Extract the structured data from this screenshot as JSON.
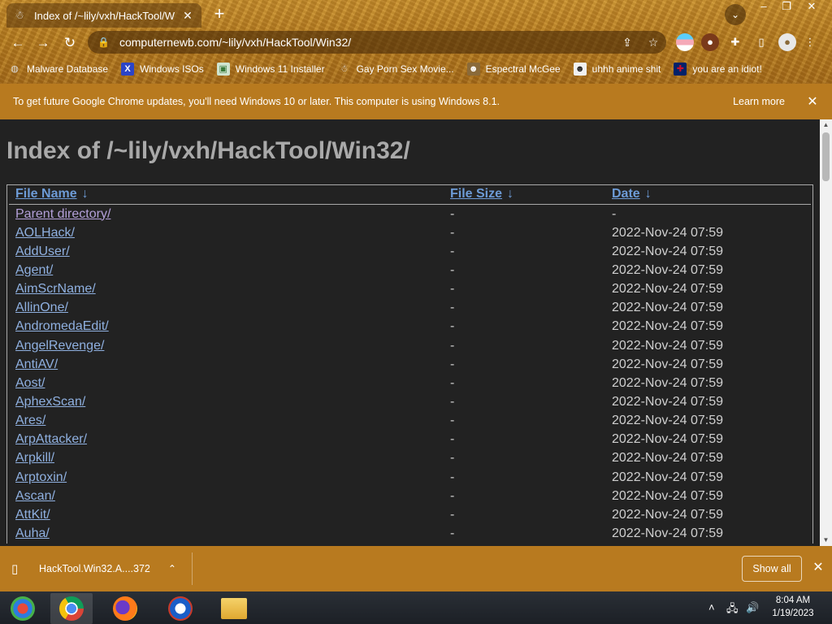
{
  "tab": {
    "title": "Index of /~lily/vxh/HackTool/W",
    "close": "✕"
  },
  "omnibox": {
    "url": "computernewb.com/~lily/vxh/HackTool/Win32/"
  },
  "bookmarks": [
    {
      "label": "Malware Database",
      "icon": "globe-icon",
      "color": "#6b6b6b"
    },
    {
      "label": "Windows ISOs",
      "icon": "x-icon",
      "color": "#2b44c8"
    },
    {
      "label": "Windows 11 Installer",
      "icon": "image-icon",
      "color": "#4a9a4a"
    },
    {
      "label": "Gay Porn Sex Movie...",
      "icon": "site-icon",
      "color": "#555555"
    },
    {
      "label": "Espectral McGee",
      "icon": "avatar-icon",
      "color": "#8a6a3a"
    },
    {
      "label": "uhhh anime shit",
      "icon": "avatar-icon",
      "color": "#f0f0f0"
    },
    {
      "label": "you are an idiot!",
      "icon": "flag-icon",
      "color": "#c8102e"
    }
  ],
  "infobar": {
    "message": "To get future Google Chrome updates, you'll need Windows 10 or later. This computer is using Windows 8.1.",
    "learn_more": "Learn more"
  },
  "page": {
    "heading": "Index of /~lily/vxh/HackTool/Win32/",
    "columns": {
      "name": "File Name",
      "size": "File Size",
      "date": "Date",
      "sort_arrow": "↓"
    },
    "rows": [
      {
        "name": "Parent directory/",
        "size": "-",
        "date": "-",
        "visited": true
      },
      {
        "name": "AOLHack/",
        "size": "-",
        "date": "2022-Nov-24 07:59",
        "visited": false
      },
      {
        "name": "AddUser/",
        "size": "-",
        "date": "2022-Nov-24 07:59",
        "visited": false
      },
      {
        "name": "Agent/",
        "size": "-",
        "date": "2022-Nov-24 07:59",
        "visited": false
      },
      {
        "name": "AimScrName/",
        "size": "-",
        "date": "2022-Nov-24 07:59",
        "visited": false
      },
      {
        "name": "AllinOne/",
        "size": "-",
        "date": "2022-Nov-24 07:59",
        "visited": false
      },
      {
        "name": "AndromedaEdit/",
        "size": "-",
        "date": "2022-Nov-24 07:59",
        "visited": false
      },
      {
        "name": "AngelRevenge/",
        "size": "-",
        "date": "2022-Nov-24 07:59",
        "visited": false
      },
      {
        "name": "AntiAV/",
        "size": "-",
        "date": "2022-Nov-24 07:59",
        "visited": false
      },
      {
        "name": "Aost/",
        "size": "-",
        "date": "2022-Nov-24 07:59",
        "visited": false
      },
      {
        "name": "AphexScan/",
        "size": "-",
        "date": "2022-Nov-24 07:59",
        "visited": false
      },
      {
        "name": "Ares/",
        "size": "-",
        "date": "2022-Nov-24 07:59",
        "visited": false
      },
      {
        "name": "ArpAttacker/",
        "size": "-",
        "date": "2022-Nov-24 07:59",
        "visited": false
      },
      {
        "name": "Arpkill/",
        "size": "-",
        "date": "2022-Nov-24 07:59",
        "visited": false
      },
      {
        "name": "Arptoxin/",
        "size": "-",
        "date": "2022-Nov-24 07:59",
        "visited": false
      },
      {
        "name": "Ascan/",
        "size": "-",
        "date": "2022-Nov-24 07:59",
        "visited": false
      },
      {
        "name": "AttKit/",
        "size": "-",
        "date": "2022-Nov-24 07:59",
        "visited": false
      },
      {
        "name": "Auha/",
        "size": "-",
        "date": "2022-Nov-24 07:59",
        "visited": false
      }
    ]
  },
  "download": {
    "filename": "HackTool.Win32.A....372",
    "show_all": "Show all"
  },
  "taskbar": {
    "apps": [
      {
        "name": "recordpad-icon",
        "active": false
      },
      {
        "name": "chrome-icon",
        "active": true
      },
      {
        "name": "firefox-icon",
        "active": false
      },
      {
        "name": "outlook-icon",
        "active": false
      },
      {
        "name": "file-explorer-icon",
        "active": false
      }
    ],
    "time": "8:04 AM",
    "date": "1/19/2023"
  },
  "colors": {
    "frame": "#b87a1f",
    "page_bg": "#222222",
    "link": "#8fb0e0",
    "visited": "#b3a0d8"
  }
}
